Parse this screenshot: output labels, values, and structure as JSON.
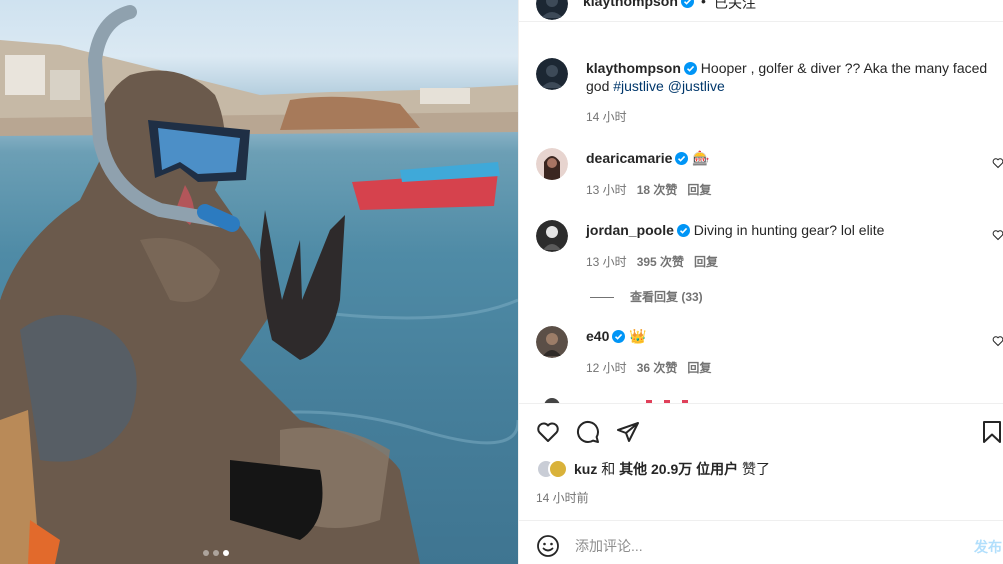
{
  "post": {
    "author": "klaythompson",
    "follow_status": "已关注",
    "separator": "•",
    "more_label": "···"
  },
  "caption": {
    "author": "klaythompson",
    "text": "Hooper , golfer & diver ?? Aka the many faced god",
    "hashtag": "#justlive",
    "mention": "@justlive",
    "time": "14 小时"
  },
  "comments": [
    {
      "author": "dearicamarie",
      "text": "🎰",
      "time": "13 小时",
      "likes": "18 次赞",
      "reply": "回复"
    },
    {
      "author": "jordan_poole",
      "text": "Diving in hunting gear? lol elite",
      "time": "13 小时",
      "likes": "395 次赞",
      "reply": "回复"
    },
    {
      "author": "e40",
      "text": "👑",
      "time": "12 小时",
      "likes": "36 次赞",
      "reply": "回复"
    }
  ],
  "view_replies": "查看回复 (33)",
  "likes_bar": {
    "liker": "kuz",
    "connector": "和",
    "others": "其他 20.9万 位用户",
    "suffix": "赞了"
  },
  "post_time": "14 小时前",
  "add_comment": {
    "placeholder": "添加评论...",
    "post_label": "发布"
  },
  "carousel": {
    "count": 3,
    "active": 3
  },
  "colors": {
    "link": "#00376b",
    "verified": "#0095f6",
    "muted": "#737373",
    "post_btn": "#b2dffc"
  },
  "icons": [
    "heart-icon",
    "comment-icon",
    "share-icon",
    "bookmark-icon",
    "emoji-icon",
    "verified-icon",
    "more-icon"
  ]
}
